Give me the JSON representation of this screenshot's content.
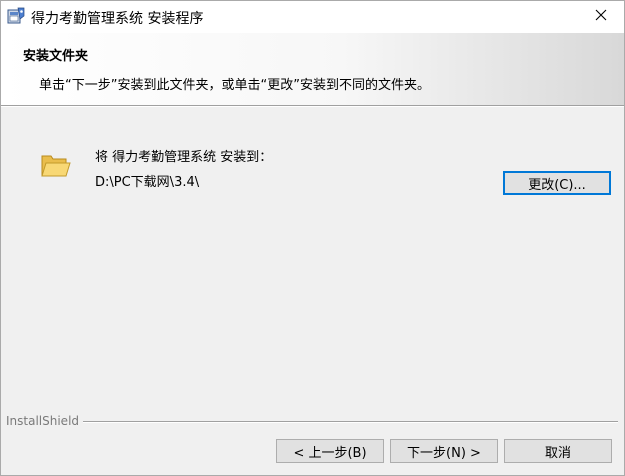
{
  "window": {
    "title": "得力考勤管理系统 安装程序",
    "close_symbol": "✕"
  },
  "banner": {
    "title": "安装文件夹",
    "description": "单击“下一步”安装到此文件夹，或单击“更改”安装到不同的文件夹。"
  },
  "content": {
    "install_to_label": "将 得力考勤管理系统 安装到：",
    "install_path": "D:\\PC下载网\\3.4\\",
    "change_button": "更改(C)..."
  },
  "footer": {
    "brand": "InstallShield",
    "back_button": "< 上一步(B)",
    "next_button": "下一步(N) >",
    "cancel_button": "取消"
  },
  "icons": {
    "app": "installer-app-icon",
    "folder": "folder-icon",
    "close": "close-icon"
  },
  "colors": {
    "accent": "#0078d7",
    "folder": "#f5d66b",
    "background": "#f0f0f0"
  }
}
